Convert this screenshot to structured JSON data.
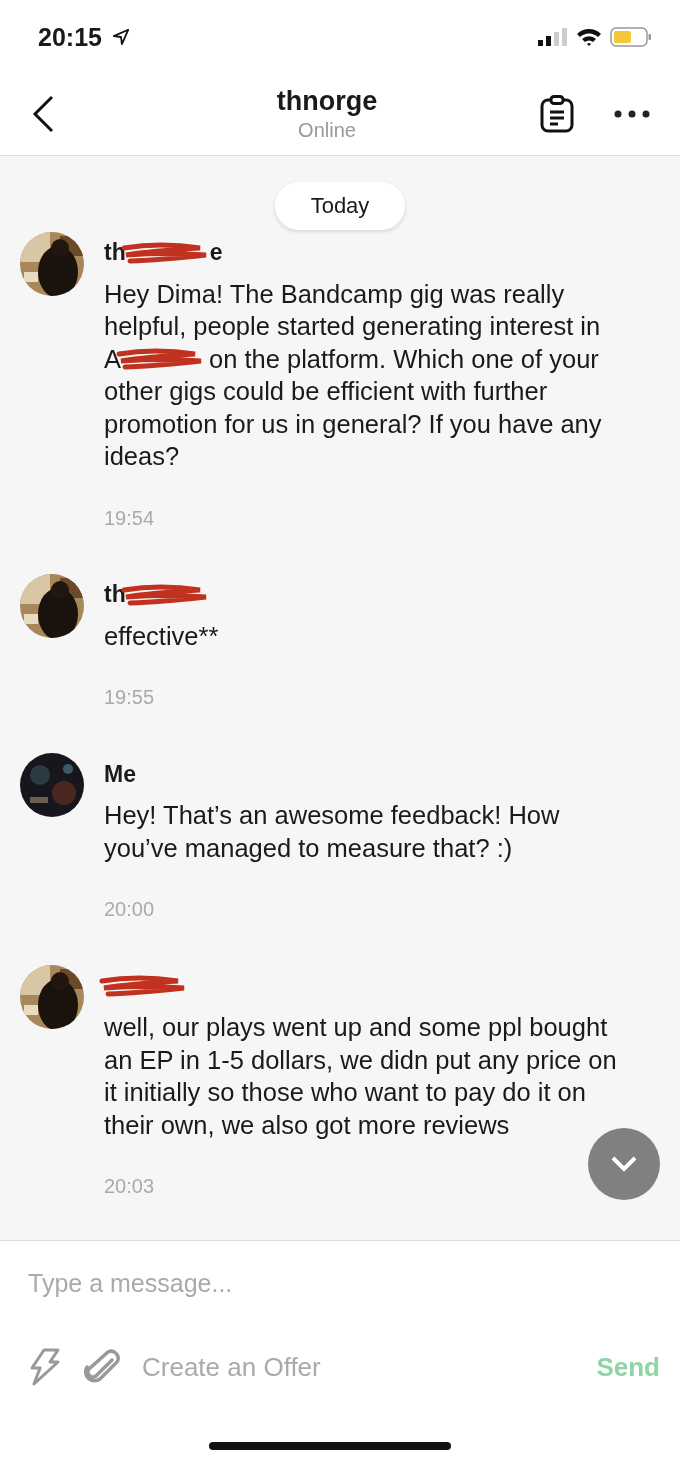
{
  "status_bar": {
    "time": "20:15"
  },
  "header": {
    "title": "thnorge",
    "subtitle": "Online"
  },
  "date_pill": "Today",
  "messages": [
    {
      "name_parts": [
        {
          "kind": "text",
          "text": "th"
        },
        {
          "kind": "redaction"
        },
        {
          "kind": "text",
          "text": "e"
        }
      ],
      "lines": [
        [
          {
            "kind": "text",
            "text": "Hey Dima! The Bandcamp gig was really"
          }
        ],
        [
          {
            "kind": "text",
            "text": "helpful, people started generating interest in"
          }
        ],
        [
          {
            "kind": "text",
            "text": "A"
          },
          {
            "kind": "redaction"
          },
          {
            "kind": "text",
            "text": "on the platform. Which one of your"
          }
        ],
        [
          {
            "kind": "text",
            "text": "other gigs could be efficient with further"
          }
        ],
        [
          {
            "kind": "text",
            "text": "promotion for us in general? If you have any"
          }
        ],
        [
          {
            "kind": "text",
            "text": "ideas?"
          }
        ]
      ],
      "time": "19:54"
    },
    {
      "name_parts": [
        {
          "kind": "text",
          "text": "th"
        },
        {
          "kind": "redaction"
        }
      ],
      "lines": [
        [
          {
            "kind": "text",
            "text": "effective**"
          }
        ]
      ],
      "time": "19:55"
    },
    {
      "name_parts": [
        {
          "kind": "text",
          "text": "Me"
        }
      ],
      "lines": [
        [
          {
            "kind": "text",
            "text": "Hey! That’s an awesome feedback! How"
          }
        ],
        [
          {
            "kind": "text",
            "text": "you’ve managed to measure that? :)"
          }
        ]
      ],
      "time": "20:00"
    },
    {
      "name_parts": [
        {
          "kind": "redaction"
        }
      ],
      "lines": [
        [
          {
            "kind": "text",
            "text": "well, our plays went up and some ppl bought"
          }
        ],
        [
          {
            "kind": "text",
            "text": "an EP in 1-5 dollars, we didn put any price on"
          }
        ],
        [
          {
            "kind": "text",
            "text": "it initially so those who want to pay do it on"
          }
        ],
        [
          {
            "kind": "text",
            "text": "their own, we also got more reviews"
          }
        ]
      ],
      "time": "20:03"
    }
  ],
  "composer": {
    "placeholder": "Type a message...",
    "offer": "Create an Offer",
    "send": "Send"
  }
}
